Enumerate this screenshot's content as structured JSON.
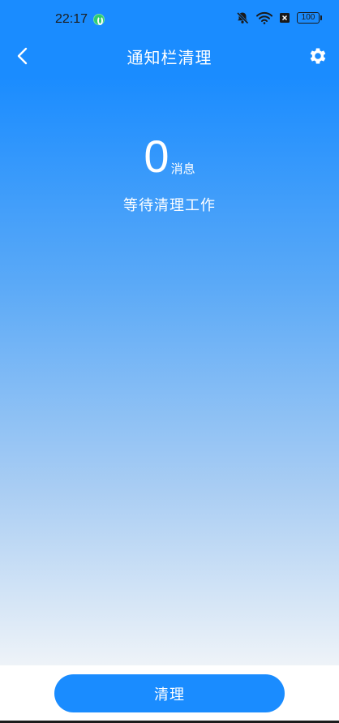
{
  "status_bar": {
    "time": "22:17",
    "battery_level": "100",
    "icons": [
      "notification-dot-icon",
      "mute-bell-icon",
      "wifi-icon",
      "sim-icon",
      "battery-icon"
    ]
  },
  "app_bar": {
    "title": "通知栏清理",
    "back_icon": "chevron-left-icon",
    "settings_icon": "gear-icon"
  },
  "summary": {
    "count": "0",
    "count_unit": "消息",
    "status": "等待清理工作"
  },
  "actions": {
    "clean_label": "清理"
  },
  "colors": {
    "primary": "#1a8cff",
    "gradient_end": "#eef3f8"
  }
}
